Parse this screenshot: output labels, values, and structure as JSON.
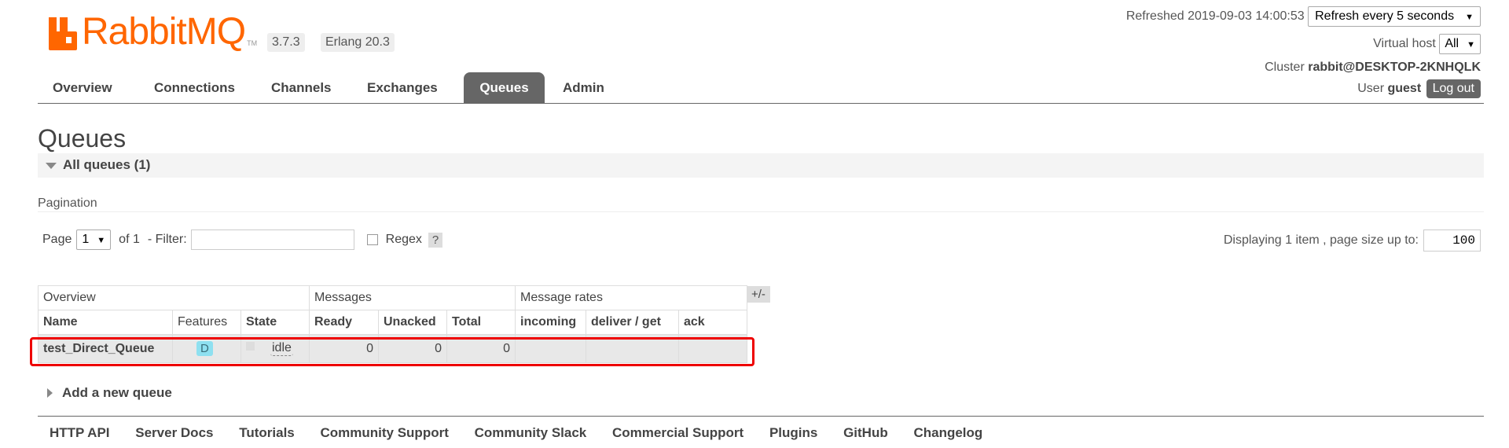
{
  "header": {
    "logo_text": "RabbitMQ",
    "logo_tm": "TM",
    "version": "3.7.3",
    "erlang": "Erlang 20.3",
    "refreshed_label": "Refreshed 2019-09-03 14:00:53",
    "refresh_select": "Refresh every 5 seconds",
    "vhost_label": "Virtual host",
    "vhost_select": "All",
    "cluster_label": "Cluster",
    "cluster_name": "rabbit@DESKTOP-2KNHQLK",
    "user_label": "User",
    "user_name": "guest",
    "logout_label": "Log out"
  },
  "nav": {
    "tabs": [
      {
        "label": "Overview"
      },
      {
        "label": "Connections"
      },
      {
        "label": "Channels"
      },
      {
        "label": "Exchanges"
      },
      {
        "label": "Queues",
        "active": true
      },
      {
        "label": "Admin"
      }
    ]
  },
  "main": {
    "title": "Queues",
    "section_label": "All queues (1)",
    "pagination": {
      "label": "Pagination",
      "page_label": "Page",
      "page_value": "1",
      "of_label": "of 1",
      "filter_label": "- Filter:",
      "filter_value": "",
      "regex_label": "Regex",
      "help_label": "?",
      "display_label": "Displaying 1 item , page size up to:",
      "page_size": "100"
    },
    "table": {
      "groups": [
        "Overview",
        "Messages",
        "Message rates"
      ],
      "toggle_label": "+/-",
      "columns": [
        "Name",
        "Features",
        "State",
        "Ready",
        "Unacked",
        "Total",
        "incoming",
        "deliver / get",
        "ack"
      ],
      "rows": [
        {
          "name": "test_Direct_Queue",
          "feature": "D",
          "state": "idle",
          "ready": "0",
          "unacked": "0",
          "total": "0",
          "incoming": "",
          "deliver_get": "",
          "ack": ""
        }
      ]
    },
    "add_queue_label": "Add a new queue"
  },
  "footer": {
    "links": [
      "HTTP API",
      "Server Docs",
      "Tutorials",
      "Community Support",
      "Community Slack",
      "Commercial Support",
      "Plugins",
      "GitHub",
      "Changelog"
    ]
  },
  "colors": {
    "brand": "#ff6600",
    "nav_active": "#666666",
    "highlight": "#ee0000",
    "feature_badge": "#8ee0f0"
  }
}
